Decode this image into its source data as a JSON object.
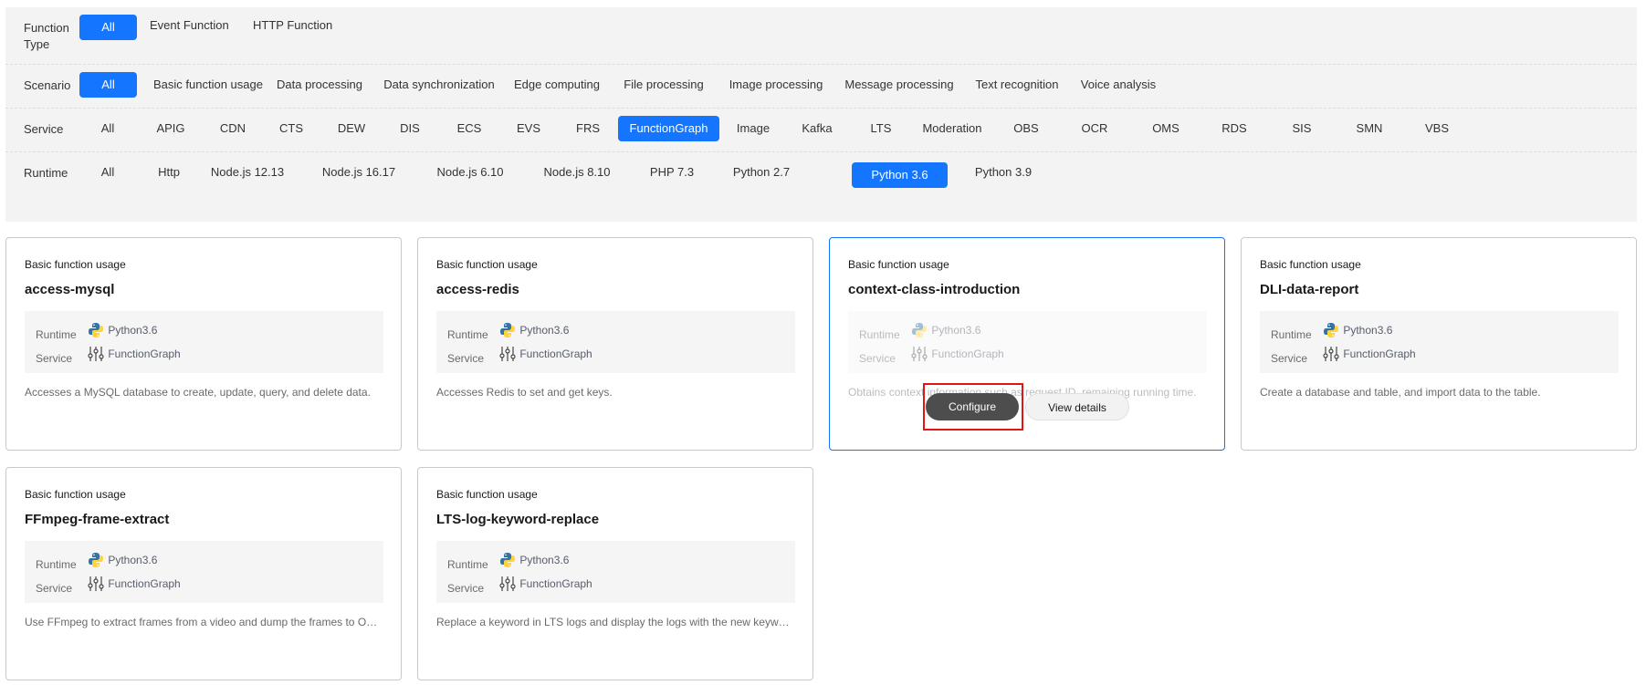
{
  "filters": {
    "function_type": {
      "label": "Function Type",
      "options": [
        "All",
        "Event Function",
        "HTTP Function"
      ],
      "selected": "All"
    },
    "scenario": {
      "label": "Scenario",
      "options": [
        "All",
        "Basic function usage",
        "Data processing",
        "Data synchronization",
        "Edge computing",
        "File processing",
        "Image processing",
        "Message processing",
        "Text recognition",
        "Voice analysis"
      ],
      "selected": "All"
    },
    "service": {
      "label": "Service",
      "options": [
        "All",
        "APIG",
        "CDN",
        "CTS",
        "DEW",
        "DIS",
        "ECS",
        "EVS",
        "FRS",
        "FunctionGraph",
        "Image",
        "Kafka",
        "LTS",
        "Moderation",
        "OBS",
        "OCR",
        "OMS",
        "RDS",
        "SIS",
        "SMN",
        "VBS"
      ],
      "selected": "FunctionGraph"
    },
    "runtime": {
      "label": "Runtime",
      "options": [
        "All",
        "Http",
        "Node.js 12.13",
        "Node.js 16.17",
        "Node.js 6.10",
        "Node.js 8.10",
        "PHP 7.3",
        "Python 2.7",
        "Python 3.6",
        "Python 3.9"
      ],
      "selected": "Python 3.6"
    }
  },
  "info_labels": {
    "runtime": "Runtime",
    "service": "Service"
  },
  "cards": [
    {
      "category": "Basic function usage",
      "name": "access-mysql",
      "runtime": "Python3.6",
      "service": "FunctionGraph",
      "description": "Accesses a MySQL database to create, update, query, and delete data."
    },
    {
      "category": "Basic function usage",
      "name": "access-redis",
      "runtime": "Python3.6",
      "service": "FunctionGraph",
      "description": "Accesses Redis to set and get keys."
    },
    {
      "category": "Basic function usage",
      "name": "context-class-introduction",
      "runtime": "Python3.6",
      "service": "FunctionGraph",
      "description": "Obtains context information such as request ID, remaining running time."
    },
    {
      "category": "Basic function usage",
      "name": "DLI-data-report",
      "runtime": "Python3.6",
      "service": "FunctionGraph",
      "description": "Create a database and table, and import data to the table."
    },
    {
      "category": "Basic function usage",
      "name": "FFmpeg-frame-extract",
      "runtime": "Python3.6",
      "service": "FunctionGraph",
      "description": "Use FFmpeg to extract frames from a video and dump the frames to OBS."
    },
    {
      "category": "Basic function usage",
      "name": "LTS-log-keyword-replace",
      "runtime": "Python3.6",
      "service": "FunctionGraph",
      "description": "Replace a keyword in LTS logs and display the logs with the new keyword."
    }
  ],
  "hover_actions": {
    "configure": "Configure",
    "view_details": "View details"
  },
  "colors": {
    "accent": "#1476ff",
    "configure_bg": "#4d4d4d",
    "highlight": "#e01616"
  }
}
